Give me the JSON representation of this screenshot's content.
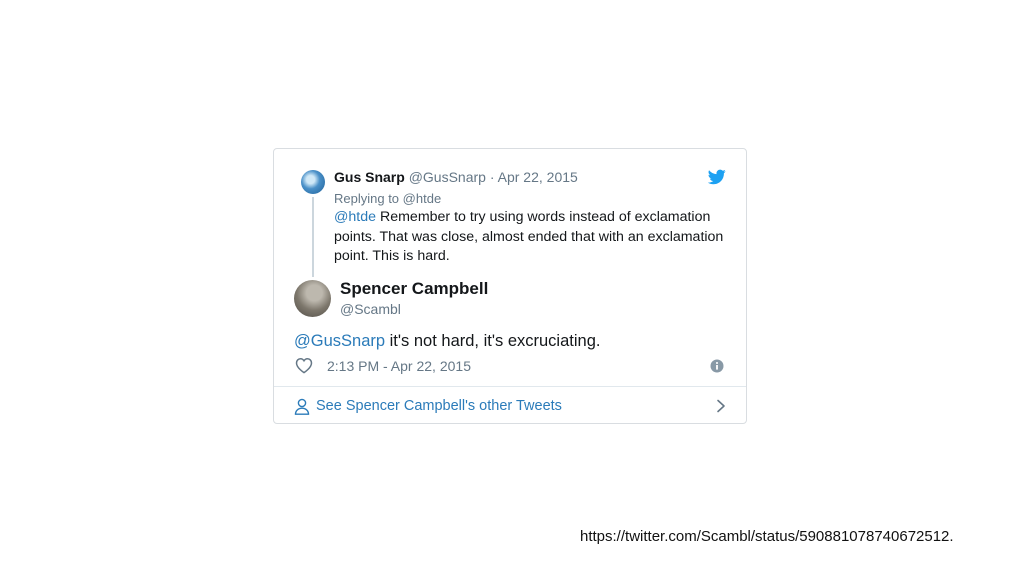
{
  "parent_tweet": {
    "name": "Gus Snarp",
    "handle": "@GusSnarp",
    "date": "Apr 22, 2015",
    "replying_prefix": "Replying to",
    "replying_to": "@htde",
    "mention": "@htde",
    "text": "Remember to try using words instead of exclamation points. That was close, almost ended that with an exclamation point. This is hard."
  },
  "main_tweet": {
    "name": "Spencer Campbell",
    "handle": "@Scambl",
    "mention": "@GusSnarp",
    "text": "it's not hard, it's excruciating.",
    "timestamp": "2:13 PM - Apr 22, 2015"
  },
  "footer": {
    "label": "See Spencer Campbell's other Tweets"
  },
  "caption": {
    "url": "https://twitter.com/Scambl/status/590881078740672512."
  },
  "colors": {
    "link": "#2b7bb9",
    "twitter_blue": "#1da1f2",
    "secondary_text": "#657786",
    "border": "#d9dde1"
  },
  "icons": {
    "brand": "twitter-bird-icon",
    "like": "heart-icon",
    "info": "info-icon",
    "profile": "person-icon",
    "more": "chevron-right-icon"
  }
}
